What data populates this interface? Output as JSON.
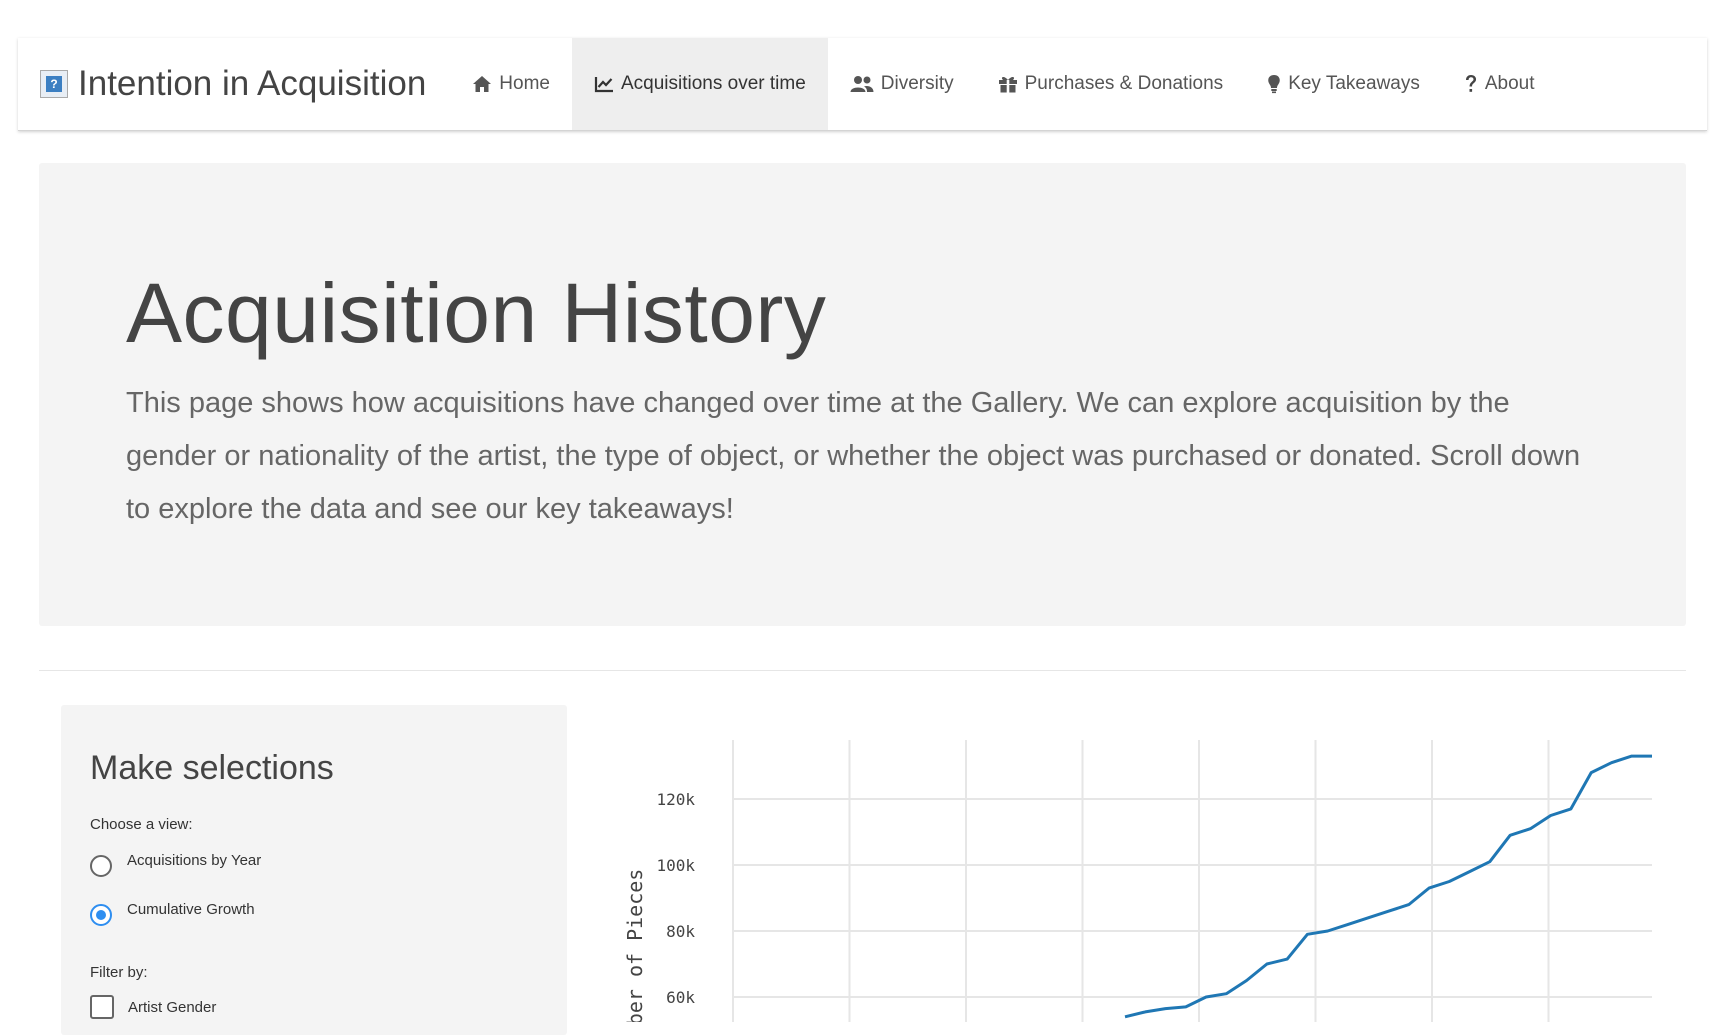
{
  "brand": {
    "title": "Intention in Acquisition"
  },
  "nav": {
    "items": [
      {
        "label": "Home",
        "icon": "home-icon"
      },
      {
        "label": "Acquisitions over time",
        "icon": "line-chart-icon",
        "active": true
      },
      {
        "label": "Diversity",
        "icon": "users-icon"
      },
      {
        "label": "Purchases & Donations",
        "icon": "gift-icon"
      },
      {
        "label": "Key Takeaways",
        "icon": "lightbulb-icon"
      },
      {
        "label": "About",
        "icon": "question-icon"
      }
    ]
  },
  "hero": {
    "title": "Acquisition History",
    "description": "This page shows how acquisitions have changed over time at the Gallery. We can explore acquisition by the gender or nationality of the artist, the type of object, or whether the object was purchased or donated. Scroll down to explore the data and see our key takeaways!"
  },
  "sidebar": {
    "title": "Make selections",
    "view_label": "Choose a view:",
    "view_options": [
      {
        "label": "Acquisitions by Year",
        "checked": false
      },
      {
        "label": "Cumulative Growth",
        "checked": true
      }
    ],
    "filter_label": "Filter by:",
    "filters": [
      {
        "label": "Artist Gender",
        "checked": false
      }
    ]
  },
  "colors": {
    "line": "#1f77b4",
    "accent": "#2e8ef0",
    "active_nav_bg": "#eeeeee"
  },
  "chart_data": {
    "type": "line",
    "ylabel": "Number of Pieces",
    "y_ticks": [
      "60k",
      "80k",
      "100k",
      "120k"
    ],
    "series": [
      {
        "values": [
          54000,
          55500,
          56500,
          57000,
          60000,
          61000,
          65000,
          70000,
          71500,
          79000,
          80000,
          82000,
          84000,
          86000,
          88000,
          93000,
          95000,
          98000,
          101000,
          109000,
          111000,
          115000,
          117000,
          128000,
          131000,
          133000,
          133000
        ]
      }
    ]
  }
}
